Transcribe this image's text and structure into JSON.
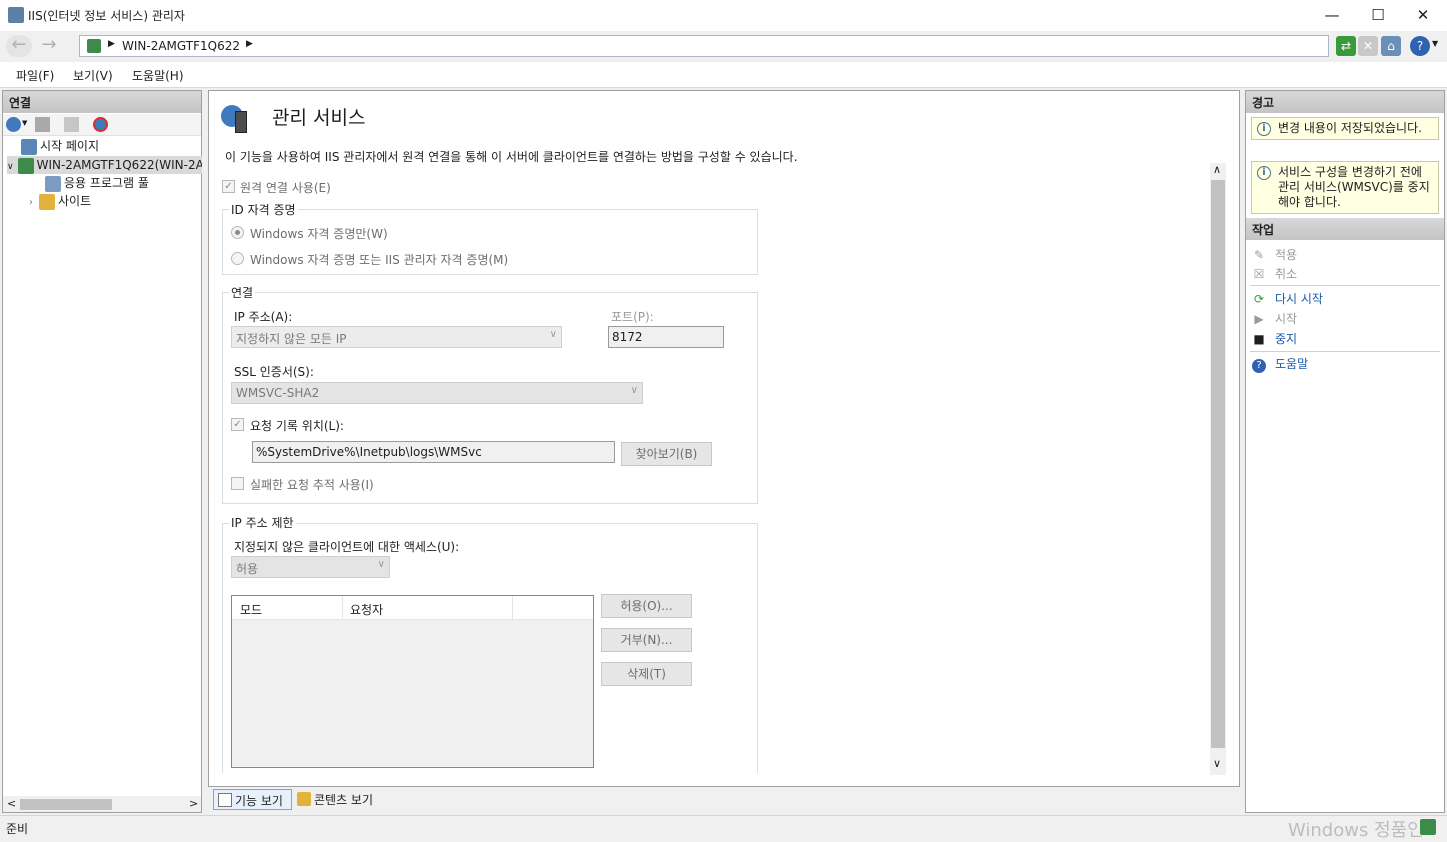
{
  "window": {
    "title": "IIS(인터넷 정보 서비스) 관리자"
  },
  "address": {
    "crumb": "WIN-2AMGTF1Q622"
  },
  "menu": [
    "파일(F)",
    "보기(V)",
    "도움말(H)"
  ],
  "left": {
    "header": "연결",
    "tree": [
      {
        "label": "시작 페이지"
      },
      {
        "label": "WIN-2AMGTF1Q622(WIN-2A"
      },
      {
        "label": "응용 프로그램 풀"
      },
      {
        "label": "사이트"
      }
    ]
  },
  "page": {
    "title": "관리 서비스",
    "description": "이 기능을 사용하여 IIS 관리자에서 원격 연결을 통해 이 서버에 클라이언트를 연결하는 방법을 구성할 수 있습니다.",
    "enable_remote": "원격 연결 사용(E)",
    "identity": {
      "title": "ID 자격 증명",
      "opt_windows": "Windows 자격 증명만(W)",
      "opt_both": "Windows 자격 증명 또는 IIS 관리자 자격 증명(M)"
    },
    "connection": {
      "title": "연결",
      "ip_label": "IP 주소(A):",
      "ip_value": "지정하지 않은 모든 IP",
      "port_label": "포트(P):",
      "port_value": "8172",
      "ssl_label": "SSL 인증서(S):",
      "ssl_value": "WMSVC-SHA2",
      "log_label": "요청 기록 위치(L):",
      "log_path": "%SystemDrive%\\Inetpub\\logs\\WMSvc",
      "browse": "찾아보기(B)",
      "failed_trace": "실패한 요청 추적 사용(I)"
    },
    "ip_restrict": {
      "title": "IP 주소 제한",
      "access_label": "지정되지 않은 클라이언트에 대한 액세스(U):",
      "access_value": "허용",
      "columns": [
        "모드",
        "요청자"
      ],
      "allow": "허용(O)...",
      "deny": "거부(N)...",
      "delete": "삭제(T)"
    }
  },
  "bottom_tabs": [
    "기능 보기",
    "콘텐츠 보기"
  ],
  "right": {
    "alerts_header": "경고",
    "alerts": [
      "변경 내용이 저장되었습니다.",
      "서비스 구성을 변경하기 전에 관리 서비스(WMSVC)를 중지해야 합니다."
    ],
    "actions_header": "작업",
    "actions": [
      "적용",
      "취소",
      "다시 시작",
      "시작",
      "중지",
      "도움말"
    ]
  },
  "status": {
    "text": "준비",
    "watermark": "Windows 정품인"
  }
}
